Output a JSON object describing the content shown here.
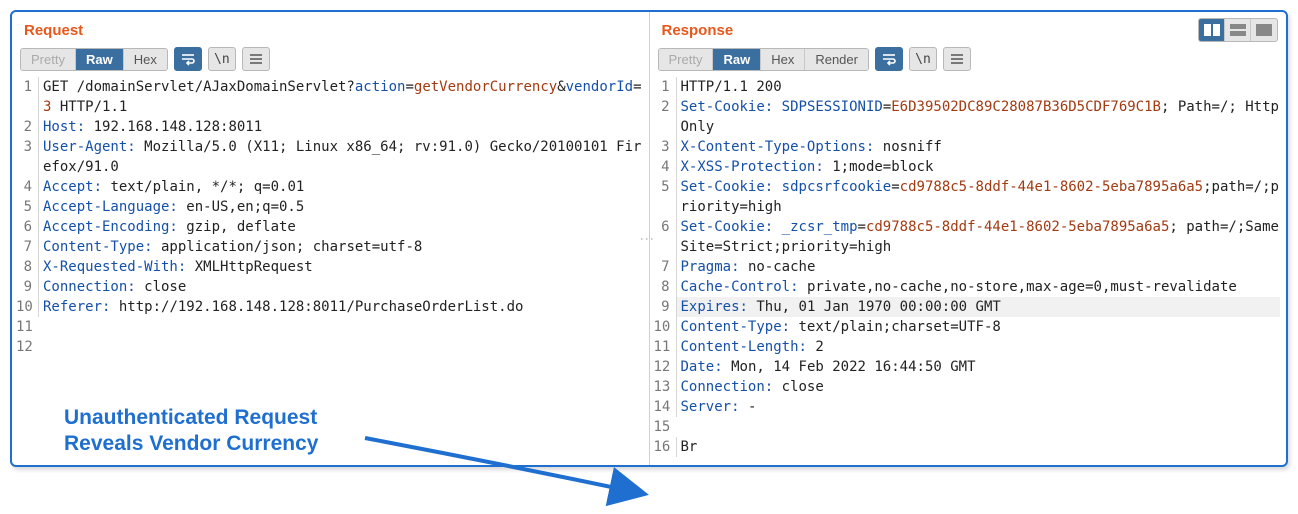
{
  "request": {
    "title": "Request",
    "tabs": {
      "pretty": "Pretty",
      "raw": "Raw",
      "hex": "Hex"
    },
    "lines": [
      {
        "n": 1,
        "segments": [
          {
            "t": "GET /domainServlet/AJaxDomainServlet?"
          },
          {
            "t": "action",
            "c": "kw-param"
          },
          {
            "t": "="
          },
          {
            "t": "getVendorCurrency",
            "c": "kw-val"
          },
          {
            "t": "&"
          },
          {
            "t": "vendorId",
            "c": "kw-param"
          },
          {
            "t": "="
          },
          {
            "t": "3",
            "c": "kw-val"
          },
          {
            "t": " HTTP/1.1"
          }
        ]
      },
      {
        "n": 2,
        "segments": [
          {
            "t": "Host:",
            "c": "kw-hdr"
          },
          {
            "t": " 192.168.148.128:8011"
          }
        ]
      },
      {
        "n": 3,
        "segments": [
          {
            "t": "User-Agent:",
            "c": "kw-hdr"
          },
          {
            "t": " Mozilla/5.0 (X11; Linux x86_64; rv:91.0) Gecko/20100101 Firefox/91.0"
          }
        ]
      },
      {
        "n": 4,
        "segments": [
          {
            "t": "Accept:",
            "c": "kw-hdr"
          },
          {
            "t": " text/plain, */*; q=0.01"
          }
        ]
      },
      {
        "n": 5,
        "segments": [
          {
            "t": "Accept-Language:",
            "c": "kw-hdr"
          },
          {
            "t": " en-US,en;q=0.5"
          }
        ]
      },
      {
        "n": 6,
        "segments": [
          {
            "t": "Accept-Encoding:",
            "c": "kw-hdr"
          },
          {
            "t": " gzip, deflate"
          }
        ]
      },
      {
        "n": 7,
        "segments": [
          {
            "t": "Content-Type:",
            "c": "kw-hdr"
          },
          {
            "t": " application/json; charset=utf-8"
          }
        ]
      },
      {
        "n": 8,
        "segments": [
          {
            "t": "X-Requested-With:",
            "c": "kw-hdr"
          },
          {
            "t": " XMLHttpRequest"
          }
        ]
      },
      {
        "n": 9,
        "segments": [
          {
            "t": "Connection:",
            "c": "kw-hdr"
          },
          {
            "t": " close"
          }
        ]
      },
      {
        "n": 10,
        "segments": [
          {
            "t": "Referer:",
            "c": "kw-hdr"
          },
          {
            "t": " http://192.168.148.128:8011/PurchaseOrderList.do"
          }
        ]
      },
      {
        "n": 11,
        "segments": [
          {
            "t": ""
          }
        ]
      },
      {
        "n": 12,
        "segments": [
          {
            "t": ""
          }
        ],
        "hl": true
      }
    ]
  },
  "response": {
    "title": "Response",
    "tabs": {
      "pretty": "Pretty",
      "raw": "Raw",
      "hex": "Hex",
      "render": "Render"
    },
    "lines": [
      {
        "n": 1,
        "segments": [
          {
            "t": "HTTP/1.1 200"
          }
        ]
      },
      {
        "n": 2,
        "segments": [
          {
            "t": "Set-Cookie:",
            "c": "kw-hdr"
          },
          {
            "t": " "
          },
          {
            "t": "SDPSESSIONID",
            "c": "kw-param"
          },
          {
            "t": "="
          },
          {
            "t": "E6D39502DC89C28087B36D5CDF769C1B",
            "c": "kw-val"
          },
          {
            "t": "; Path=/; HttpOnly"
          }
        ]
      },
      {
        "n": 3,
        "segments": [
          {
            "t": "X-Content-Type-Options:",
            "c": "kw-hdr"
          },
          {
            "t": " nosniff"
          }
        ]
      },
      {
        "n": 4,
        "segments": [
          {
            "t": "X-XSS-Protection:",
            "c": "kw-hdr"
          },
          {
            "t": " 1;mode=block"
          }
        ]
      },
      {
        "n": 5,
        "segments": [
          {
            "t": "Set-Cookie:",
            "c": "kw-hdr"
          },
          {
            "t": " "
          },
          {
            "t": "sdpcsrfcookie",
            "c": "kw-param"
          },
          {
            "t": "="
          },
          {
            "t": "cd9788c5-8ddf-44e1-8602-5eba7895a6a5",
            "c": "kw-val"
          },
          {
            "t": ";path=/;priority=high"
          }
        ]
      },
      {
        "n": 6,
        "segments": [
          {
            "t": "Set-Cookie:",
            "c": "kw-hdr"
          },
          {
            "t": " "
          },
          {
            "t": "_zcsr_tmp",
            "c": "kw-param"
          },
          {
            "t": "="
          },
          {
            "t": "cd9788c5-8ddf-44e1-8602-5eba7895a6a5",
            "c": "kw-val"
          },
          {
            "t": "; path=/;SameSite=Strict;priority=high"
          }
        ]
      },
      {
        "n": 7,
        "segments": [
          {
            "t": "Pragma:",
            "c": "kw-hdr"
          },
          {
            "t": " no-cache"
          }
        ]
      },
      {
        "n": 8,
        "segments": [
          {
            "t": "Cache-Control:",
            "c": "kw-hdr"
          },
          {
            "t": " private,no-cache,no-store,max-age=0,must-revalidate"
          }
        ]
      },
      {
        "n": 9,
        "segments": [
          {
            "t": "Expires:",
            "c": "kw-hdr"
          },
          {
            "t": " Thu, 01 Jan 1970 00:00:00 GMT"
          }
        ],
        "hl": true
      },
      {
        "n": 10,
        "segments": [
          {
            "t": "Content-Type:",
            "c": "kw-hdr"
          },
          {
            "t": " text/plain;charset=UTF-8"
          }
        ]
      },
      {
        "n": 11,
        "segments": [
          {
            "t": "Content-Length:",
            "c": "kw-hdr"
          },
          {
            "t": " 2"
          }
        ]
      },
      {
        "n": 12,
        "segments": [
          {
            "t": "Date:",
            "c": "kw-hdr"
          },
          {
            "t": " Mon, 14 Feb 2022 16:44:50 GMT"
          }
        ]
      },
      {
        "n": 13,
        "segments": [
          {
            "t": "Connection:",
            "c": "kw-hdr"
          },
          {
            "t": " close"
          }
        ]
      },
      {
        "n": 14,
        "segments": [
          {
            "t": "Server:",
            "c": "kw-hdr"
          },
          {
            "t": " -"
          }
        ]
      },
      {
        "n": 15,
        "segments": [
          {
            "t": ""
          }
        ]
      },
      {
        "n": 16,
        "segments": [
          {
            "t": "Br"
          }
        ]
      }
    ]
  },
  "annotation": {
    "line1": "Unauthenticated Request",
    "line2": "Reveals Vendor Currency"
  }
}
